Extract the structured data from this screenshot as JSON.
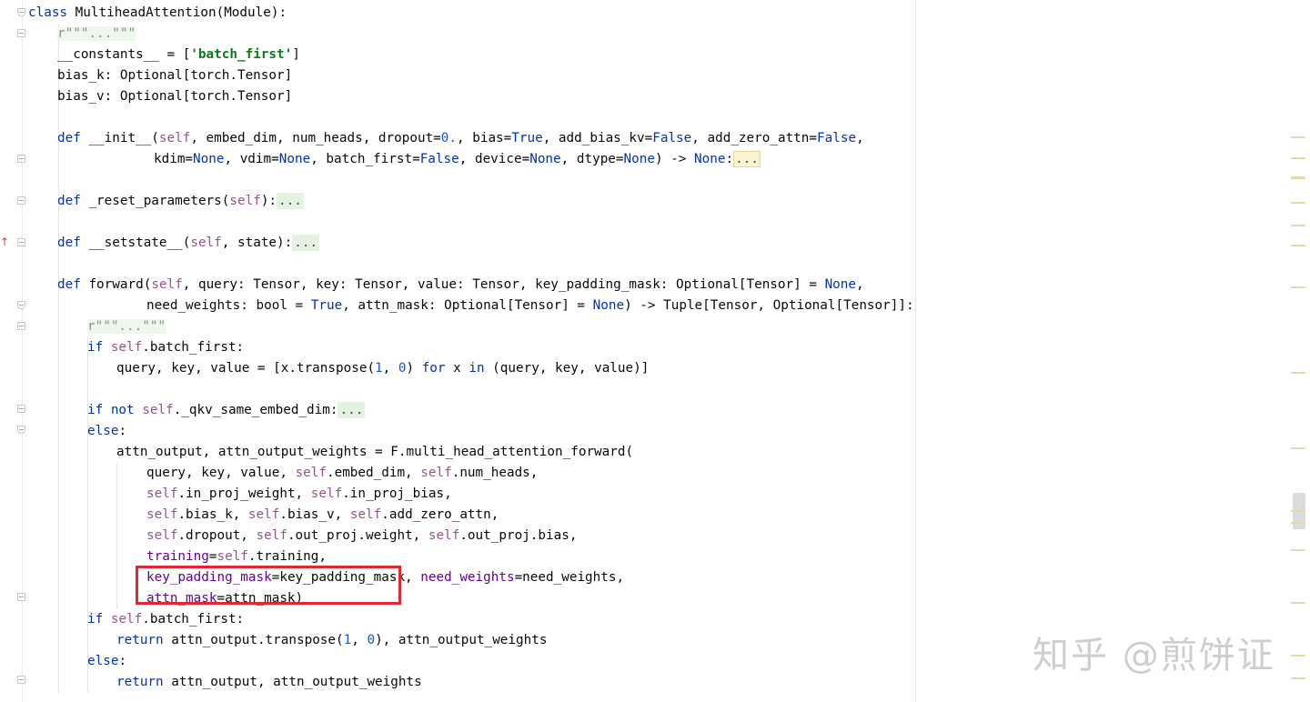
{
  "watermark": "知乎 @煎饼证",
  "colors": {
    "keyword": "#0033b3",
    "self": "#94558d",
    "string": "#067d17",
    "number": "#1750eb",
    "param": "#660099",
    "highlight_box": "#e0292e"
  },
  "code": {
    "l01": {
      "a": "class ",
      "b": "MultiheadAttention(Module):"
    },
    "l02": {
      "doc": "r\"\"\"...\"\"\""
    },
    "l03": {
      "a": "__constants__ = [",
      "s": "'batch_first'",
      "b": "]"
    },
    "l04": {
      "a": "bias_k: Optional[torch.Tensor]"
    },
    "l05": {
      "a": "bias_v: Optional[torch.Tensor]"
    },
    "l06": {
      "kw": "def ",
      "name": "__init__(",
      "self": "self",
      "rest": ", embed_dim, num_heads, dropout=",
      "n1": "0.",
      "r2": ", bias=",
      "k1": "True",
      "r3": ", add_bias_kv=",
      "k2": "False",
      "r4": ", add_zero_attn=",
      "k3": "False",
      "r5": ","
    },
    "l07": {
      "a": "kdim=",
      "k1": "None",
      "b": ", vdim=",
      "k2": "None",
      "c": ", batch_first=",
      "k3": "False",
      "d": ", device=",
      "k4": "None",
      "e": ", dtype=",
      "k5": "None",
      "f": ") -> ",
      "k6": "None",
      "g": ":",
      "ell": "..."
    },
    "l08": {
      "kw": "def ",
      "a": "_reset_parameters(",
      "self": "self",
      "b": "):",
      "ell": "..."
    },
    "l09": {
      "kw": "def ",
      "a": "__setstate__(",
      "self": "self",
      "b": ", state):",
      "ell": "..."
    },
    "l10": {
      "kw": "def ",
      "a": "forward(",
      "self": "self",
      "b": ", query: Tensor, key: Tensor, value: Tensor, key_padding_mask: Optional[Tensor] = ",
      "k1": "None",
      "c": ","
    },
    "l11": {
      "a": "need_weights: bool = ",
      "k1": "True",
      "b": ", attn_mask: Optional[Tensor] = ",
      "k2": "None",
      "c": ") -> Tuple[Tensor, Optional[Tensor]]:"
    },
    "l12": {
      "doc": "r\"\"\"...\"\"\""
    },
    "l13": {
      "kw": "if ",
      "self": "self",
      "a": ".batch_first:"
    },
    "l14": {
      "a": "query, key, value = [x.transpose(",
      "n1": "1",
      "b": ", ",
      "n2": "0",
      "c": ") ",
      "k1": "for",
      "d": " x ",
      "k2": "in",
      "e": " (query, key, value)]"
    },
    "l15": {
      "kw": "if not ",
      "self": "self",
      "a": "._qkv_same_embed_dim:",
      "ell": "..."
    },
    "l16": {
      "kw": "else",
      "a": ":"
    },
    "l17": {
      "a": "attn_output, attn_output_weights = F.multi_head_attention_forward("
    },
    "l18": {
      "a": "query, key, value, ",
      "s1": "self",
      "b": ".embed_dim, ",
      "s2": "self",
      "c": ".num_heads,"
    },
    "l19": {
      "s1": "self",
      "a": ".in_proj_weight, ",
      "s2": "self",
      "b": ".in_proj_bias,"
    },
    "l20": {
      "s1": "self",
      "a": ".bias_k, ",
      "s2": "self",
      "b": ".bias_v, ",
      "s3": "self",
      "c": ".add_zero_attn,"
    },
    "l21": {
      "s1": "self",
      "a": ".dropout, ",
      "s2": "self",
      "b": ".out_proj.weight, ",
      "s3": "self",
      "c": ".out_proj.bias,"
    },
    "l22": {
      "p": "training",
      "a": "=",
      "s1": "self",
      "b": ".training,"
    },
    "l23": {
      "p1": "key_padding_mask",
      "a": "=key_padding_mask, ",
      "p2": "need_weights",
      "b": "=need_weights,"
    },
    "l24": {
      "p": "attn_mask",
      "a": "=attn_mask)"
    },
    "l25": {
      "kw": "if ",
      "self": "self",
      "a": ".batch_first:"
    },
    "l26": {
      "kw": "return ",
      "a": "attn_output.transpose(",
      "n1": "1",
      "b": ", ",
      "n2": "0",
      "c": "), attn_output_weights"
    },
    "l27": {
      "kw": "else",
      "a": ":"
    },
    "l28": {
      "kw": "return ",
      "a": "attn_output, attn_output_weights"
    }
  }
}
